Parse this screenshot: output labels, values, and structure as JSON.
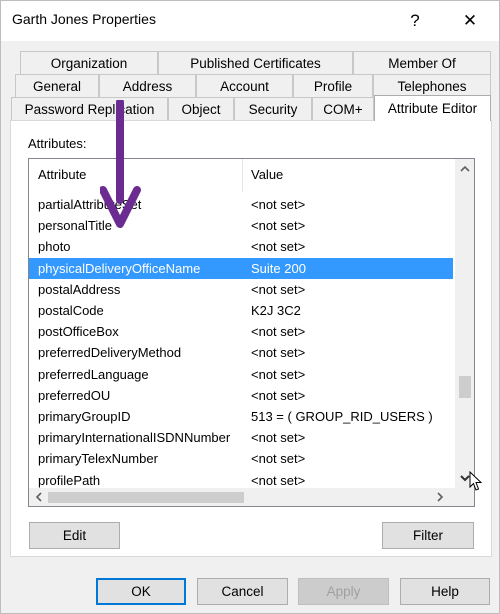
{
  "window": {
    "title": "Garth Jones Properties",
    "help_glyph": "?",
    "close_glyph": "✕"
  },
  "tabs": {
    "row1": [
      "Organization",
      "Published Certificates",
      "Member Of"
    ],
    "row2": [
      "General",
      "Address",
      "Account",
      "Profile",
      "Telephones"
    ],
    "row3": [
      "Password Replication",
      "Object",
      "Security",
      "COM+",
      "Attribute Editor"
    ],
    "active": "Attribute Editor"
  },
  "attributes": {
    "label": "Attributes:",
    "columns": [
      "Attribute",
      "Value"
    ],
    "rows": [
      {
        "attr": "partialAttributeSet",
        "value": "<not set>"
      },
      {
        "attr": "personalTitle",
        "value": "<not set>"
      },
      {
        "attr": "photo",
        "value": "<not set>"
      },
      {
        "attr": "physicalDeliveryOfficeName",
        "value": "Suite 200",
        "selected": true
      },
      {
        "attr": "postalAddress",
        "value": "<not set>"
      },
      {
        "attr": "postalCode",
        "value": "K2J 3C2"
      },
      {
        "attr": "postOfficeBox",
        "value": "<not set>"
      },
      {
        "attr": "preferredDeliveryMethod",
        "value": "<not set>"
      },
      {
        "attr": "preferredLanguage",
        "value": "<not set>"
      },
      {
        "attr": "preferredOU",
        "value": "<not set>"
      },
      {
        "attr": "primaryGroupID",
        "value": "513 = ( GROUP_RID_USERS )"
      },
      {
        "attr": "primaryInternationalISDNNumber",
        "value": "<not set>"
      },
      {
        "attr": "primaryTelexNumber",
        "value": "<not set>"
      },
      {
        "attr": "profilePath",
        "value": "<not set>"
      }
    ]
  },
  "buttons": {
    "edit": "Edit",
    "filter": "Filter",
    "ok": "OK",
    "cancel": "Cancel",
    "apply": "Apply",
    "help": "Help"
  },
  "colors": {
    "selection": "#3399ff",
    "annotation_arrow": "#6a2c91",
    "default_button_border": "#0078d7"
  }
}
